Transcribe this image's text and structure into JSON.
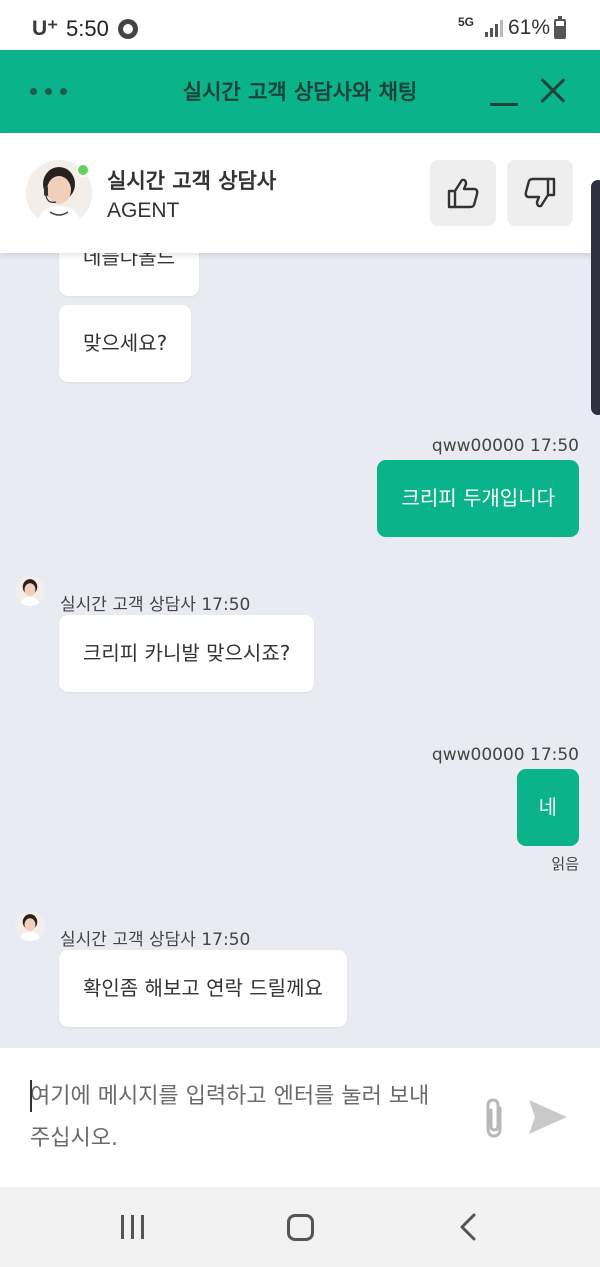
{
  "status_bar": {
    "carrier": "U⁺",
    "time": "5:50",
    "network": "5G",
    "battery": "61%"
  },
  "header": {
    "title": "실시간 고객 상담사와 채팅",
    "menu_icon": "more-dots-icon",
    "minimize_icon": "minimize-icon",
    "close_icon": "close-icon"
  },
  "agent": {
    "name": "실시간 고객 상담사",
    "role": "AGENT",
    "status_color": "#5fd35a",
    "thumbs_up_icon": "thumbs-up-icon",
    "thumbs_down_icon": "thumbs-down-icon"
  },
  "messages": [
    {
      "from": "agent",
      "text": "데들다올드"
    },
    {
      "from": "agent",
      "text": "맞으세요?"
    },
    {
      "from": "user",
      "meta": "qww00000 17:50",
      "text": "크리피 두개입니다"
    },
    {
      "from": "agent",
      "meta": "실시간 고객 상담사 17:50",
      "text": "크리피 카니발 맞으시죠?"
    },
    {
      "from": "user",
      "meta": "qww00000 17:50",
      "text": "네",
      "read": "읽음"
    },
    {
      "from": "agent",
      "meta": "실시간 고객 상담사 17:50",
      "text": "확인좀 해보고 연락 드릴께요"
    }
  ],
  "composer": {
    "placeholder": "여기에 메시지를 입력하고 엔터를 눌러 보내 주십시오.",
    "attach_icon": "paperclip-icon",
    "send_icon": "send-icon"
  },
  "nav": {
    "recents_icon": "recents-icon",
    "home_icon": "home-icon",
    "back_icon": "back-icon"
  },
  "colors": {
    "accent": "#0bb38a",
    "chat_background": "#e8ebf1"
  }
}
